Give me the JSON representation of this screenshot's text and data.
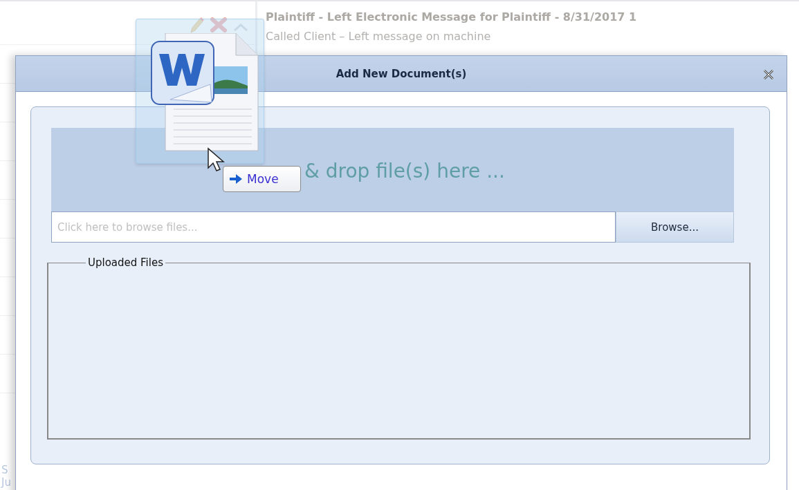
{
  "background": {
    "message_title": "Plaintiff - Left Electronic Message for Plaintiff - 8/31/2017 1",
    "message_detail": "Called Client – Left message on machine",
    "partial_texts": [
      "S",
      "Ju"
    ]
  },
  "dialog": {
    "title": "Add New Document(s)",
    "drop_zone": {
      "text": "& drop file(s) here ..."
    },
    "file_field": {
      "placeholder": "Click here to browse files..."
    },
    "browse_button": "Browse...",
    "uploaded_files": {
      "legend": "Uploaded Files"
    }
  },
  "drag": {
    "tooltip": "Move"
  }
}
